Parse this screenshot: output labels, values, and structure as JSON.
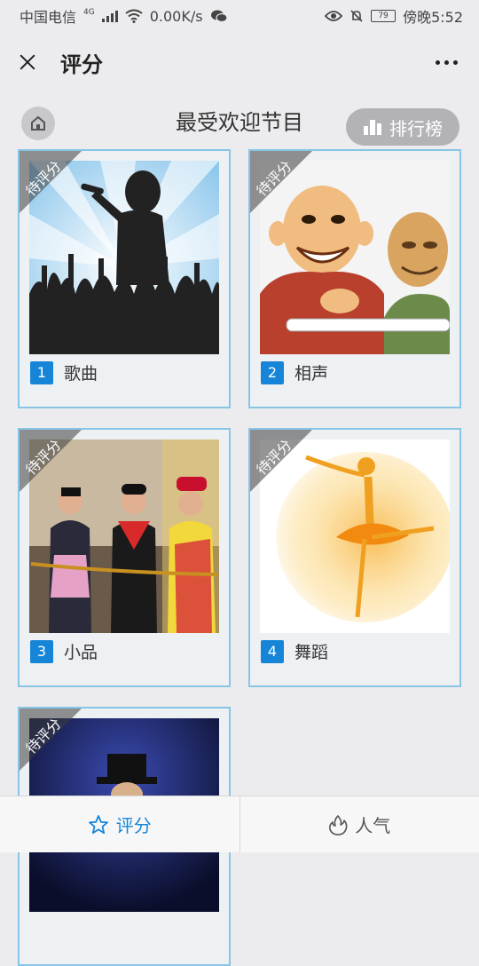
{
  "status_bar": {
    "carrier": "中国电信",
    "network": "4G",
    "speed": "0.00K/s",
    "battery": "79",
    "time": "傍晚5:52"
  },
  "header": {
    "title": "评分"
  },
  "page": {
    "title": "最受欢迎节目",
    "rank_button": "排行榜"
  },
  "ribbon_label": "待评分",
  "programs": [
    {
      "number": "1",
      "name": "歌曲",
      "image": "singer-silhouette"
    },
    {
      "number": "2",
      "name": "相声",
      "image": "crosstalk-cartoon"
    },
    {
      "number": "3",
      "name": "小品",
      "image": "sketch-performers"
    },
    {
      "number": "4",
      "name": "舞蹈",
      "image": "ballerina-watercolor"
    },
    {
      "number": "",
      "name": "",
      "image": "stage-performer"
    }
  ],
  "tabs": [
    {
      "label": "评分",
      "icon": "star-icon",
      "active": true
    },
    {
      "label": "人气",
      "icon": "fire-icon",
      "active": false
    }
  ],
  "colors": {
    "accent": "#1685d8",
    "card_border": "#88c4e6"
  }
}
